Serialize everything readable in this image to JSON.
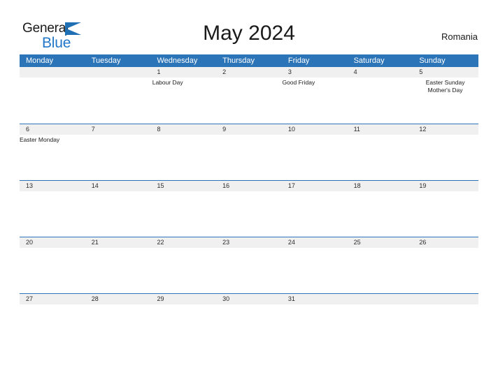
{
  "brand": {
    "logo_text_1": "General",
    "logo_text_2": "Blue",
    "flag_icon": "blue-flag-triangle",
    "accent_color": "#2277c8"
  },
  "header": {
    "title": "May 2024",
    "region": "Romania"
  },
  "calendar": {
    "header_bg": "#2b74b8",
    "date_band_bg": "#f0f0f0",
    "weekdays": [
      "Monday",
      "Tuesday",
      "Wednesday",
      "Thursday",
      "Friday",
      "Saturday",
      "Sunday"
    ],
    "weeks": [
      {
        "days": [
          {
            "date": "",
            "events": []
          },
          {
            "date": "",
            "events": []
          },
          {
            "date": "1",
            "events": [
              "Labour Day"
            ],
            "align": "left"
          },
          {
            "date": "2",
            "events": []
          },
          {
            "date": "3",
            "events": [
              "Good Friday"
            ],
            "align": "left"
          },
          {
            "date": "4",
            "events": []
          },
          {
            "date": "5",
            "events": [
              "Easter Sunday",
              "Mother's Day"
            ],
            "align": "center"
          }
        ]
      },
      {
        "days": [
          {
            "date": "6",
            "events": [
              "Easter Monday"
            ],
            "align": "left"
          },
          {
            "date": "7",
            "events": []
          },
          {
            "date": "8",
            "events": []
          },
          {
            "date": "9",
            "events": []
          },
          {
            "date": "10",
            "events": []
          },
          {
            "date": "11",
            "events": []
          },
          {
            "date": "12",
            "events": []
          }
        ]
      },
      {
        "days": [
          {
            "date": "13",
            "events": []
          },
          {
            "date": "14",
            "events": []
          },
          {
            "date": "15",
            "events": []
          },
          {
            "date": "16",
            "events": []
          },
          {
            "date": "17",
            "events": []
          },
          {
            "date": "18",
            "events": []
          },
          {
            "date": "19",
            "events": []
          }
        ]
      },
      {
        "days": [
          {
            "date": "20",
            "events": []
          },
          {
            "date": "21",
            "events": []
          },
          {
            "date": "22",
            "events": []
          },
          {
            "date": "23",
            "events": []
          },
          {
            "date": "24",
            "events": []
          },
          {
            "date": "25",
            "events": []
          },
          {
            "date": "26",
            "events": []
          }
        ]
      },
      {
        "days": [
          {
            "date": "27",
            "events": []
          },
          {
            "date": "28",
            "events": []
          },
          {
            "date": "29",
            "events": []
          },
          {
            "date": "30",
            "events": []
          },
          {
            "date": "31",
            "events": []
          },
          {
            "date": "",
            "events": []
          },
          {
            "date": "",
            "events": []
          }
        ]
      }
    ]
  }
}
